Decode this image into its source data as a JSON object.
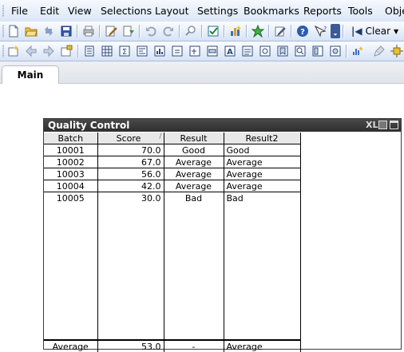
{
  "menu": {
    "items": [
      "File",
      "Edit",
      "View",
      "Selections",
      "Layout",
      "Settings",
      "Bookmarks",
      "Reports",
      "Tools",
      "Obje"
    ]
  },
  "toolbar": {
    "clear_label": "Clear",
    "icons": [
      "new-document-icon",
      "open-folder-icon",
      "reload-icon",
      "save-icon",
      "print-icon",
      "edit-script-icon",
      "reload-data-icon",
      "undo-icon",
      "redo-icon",
      "search-icon",
      "select-fields-icon",
      "chart-wizard-icon",
      "bookmark-star-icon",
      "edit-icon",
      "help-icon",
      "context-help-icon",
      "toolbar-options-icon",
      "back-icon"
    ]
  },
  "tabs": [
    {
      "label": "Main",
      "active": true
    }
  ],
  "table_box": {
    "title": "Quality Control",
    "xl_label": "XL",
    "columns": [
      "Batch",
      "Score",
      "Result",
      "Result2"
    ],
    "rows": [
      {
        "batch": "10001",
        "score": "70.0",
        "result": "Good",
        "result2": "Good"
      },
      {
        "batch": "10002",
        "score": "67.0",
        "result": "Average",
        "result2": "Average"
      },
      {
        "batch": "10003",
        "score": "56.0",
        "result": "Average",
        "result2": "Average"
      },
      {
        "batch": "10004",
        "score": "42.0",
        "result": "Average",
        "result2": "Average"
      },
      {
        "batch": "10005",
        "score": "30.0",
        "result": "Bad",
        "result2": "Bad"
      }
    ],
    "totals": {
      "batch": "Average",
      "score": "53.0",
      "result": "-",
      "result2": "Average"
    }
  },
  "colors": {
    "caption_bg": "#2e2e2e",
    "header_bg": "#e8e8e8",
    "menubar_bg": "#dbe6f6"
  }
}
